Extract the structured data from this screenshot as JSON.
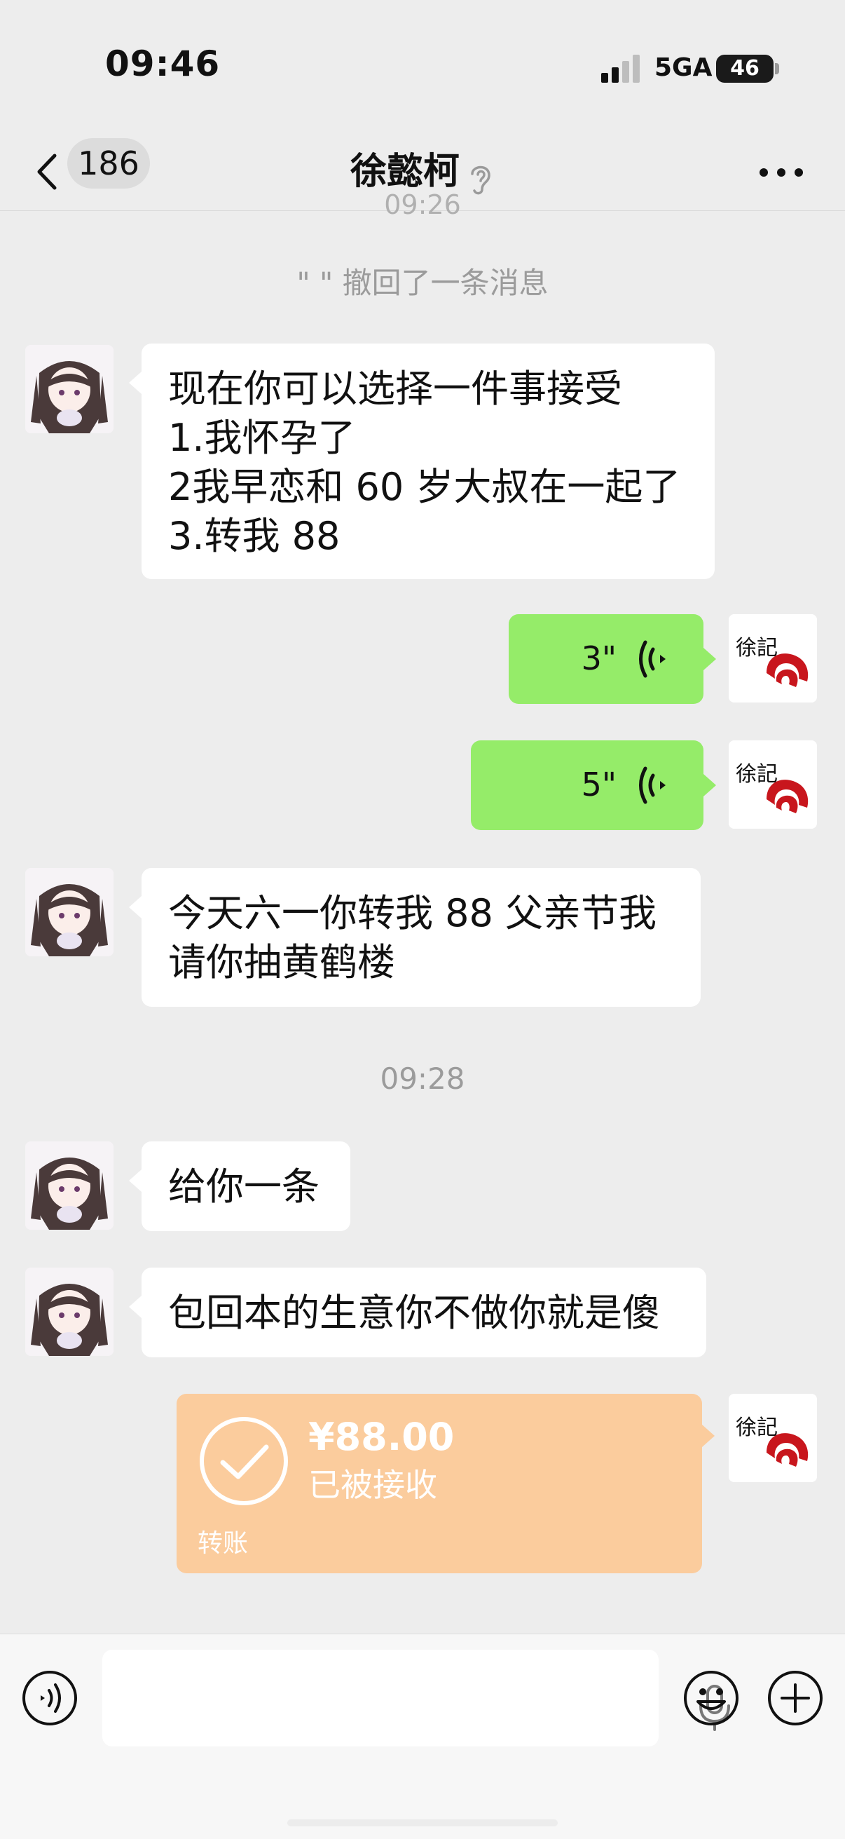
{
  "status_bar": {
    "time": "09:46",
    "network": "5GA",
    "battery": "46"
  },
  "nav": {
    "unread_count": "186",
    "title": "徐懿柯"
  },
  "messages": {
    "time_partial": "09:26",
    "recall_notice": "\"      \" 撤回了一条消息",
    "msg1_lines": [
      "现在你可以选择一件事接受",
      "1.我怀孕了",
      "2我早恋和 60 岁大叔在一起了",
      "3.转我 88"
    ],
    "voice1_duration": "3\"",
    "voice2_duration": "5\"",
    "msg2_lines": [
      "今天六一你转我 88  父亲节我",
      "请你抽黄鹤楼"
    ],
    "timestamp": "09:28",
    "msg3": "给你一条",
    "msg4": "包回本的生意你不做你就是傻"
  },
  "transfer": {
    "amount": "¥88.00",
    "status": "已被接收",
    "label": "转账"
  },
  "avatars": {
    "contact": "anime-girl-avatar",
    "self": "xu-ji-logo",
    "self_logo_text": "徐記"
  },
  "colors": {
    "outgoing_bubble": "#95ec69",
    "incoming_bubble": "#ffffff",
    "transfer_card": "#fbcc9d",
    "background": "#ededed"
  }
}
